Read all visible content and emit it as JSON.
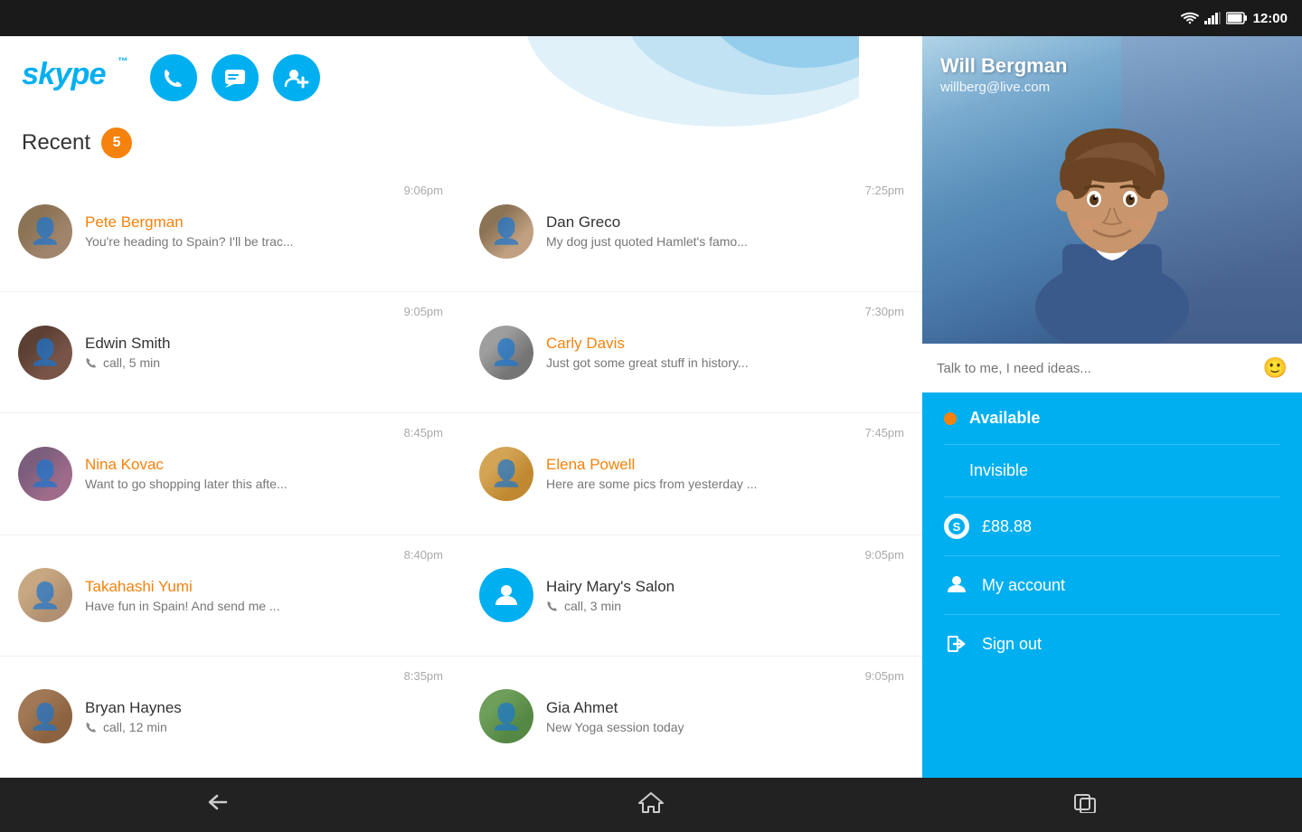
{
  "statusBar": {
    "time": "12:00",
    "wifi_icon": "wifi",
    "signal_icon": "signal",
    "battery_icon": "battery"
  },
  "toolbar": {
    "logo": "skype",
    "call_button": "📞",
    "message_button": "💬",
    "add_contact_button": "👤+"
  },
  "recent": {
    "label": "Recent",
    "badge": "5"
  },
  "conversations": [
    {
      "id": "pete",
      "name": "Pete Bergman",
      "name_color": "orange",
      "preview": "You're heading to Spain? I'll be trac...",
      "time": "9:06pm",
      "type": "message",
      "avatar_class": "avatar-pete"
    },
    {
      "id": "dan",
      "name": "Dan Greco",
      "name_color": "black",
      "preview": "My dog just quoted Hamlet's famo...",
      "time": "7:25pm",
      "type": "message",
      "avatar_class": "avatar-dan"
    },
    {
      "id": "edwin",
      "name": "Edwin Smith",
      "name_color": "black",
      "preview": "call, 5 min",
      "time": "9:05pm",
      "type": "call",
      "avatar_class": "avatar-edwin"
    },
    {
      "id": "carly",
      "name": "Carly Davis",
      "name_color": "orange",
      "preview": "Just got some great stuff in history...",
      "time": "7:30pm",
      "type": "message",
      "avatar_class": "avatar-carly"
    },
    {
      "id": "nina",
      "name": "Nina Kovac",
      "name_color": "orange",
      "preview": "Want to go shopping later this afte...",
      "time": "8:45pm",
      "type": "message",
      "avatar_class": "avatar-nina"
    },
    {
      "id": "elena",
      "name": "Elena Powell",
      "name_color": "orange",
      "preview": "Here are some pics from yesterday ...",
      "time": "7:45pm",
      "type": "message",
      "avatar_class": "avatar-elena"
    },
    {
      "id": "taka",
      "name": "Takahashi Yumi",
      "name_color": "orange",
      "preview": "Have fun in Spain! And send me ...",
      "time": "8:40pm",
      "type": "message",
      "avatar_class": "avatar-taka"
    },
    {
      "id": "hairy",
      "name": "Hairy Mary's Salon",
      "name_color": "black",
      "preview": "call, 3 min",
      "time": "9:05pm",
      "type": "call",
      "avatar_class": "placeholder"
    },
    {
      "id": "bryan",
      "name": "Bryan Haynes",
      "name_color": "black",
      "preview": "call, 12 min",
      "time": "8:35pm",
      "type": "call",
      "avatar_class": "avatar-bryan"
    },
    {
      "id": "gia",
      "name": "Gia Ahmet",
      "name_color": "black",
      "preview": "New Yoga session today",
      "time": "9:05pm",
      "type": "message",
      "avatar_class": "avatar-gia"
    }
  ],
  "profile": {
    "name": "Will Bergman",
    "email": "willberg@live.com",
    "mood_placeholder": "Talk to me, I need ideas...",
    "status": "Available",
    "invisible": "Invisible",
    "credits": "£88.88",
    "my_account": "My account",
    "sign_out": "Sign out"
  },
  "navBar": {
    "back": "←",
    "home": "⌂",
    "recent_apps": "▭"
  }
}
